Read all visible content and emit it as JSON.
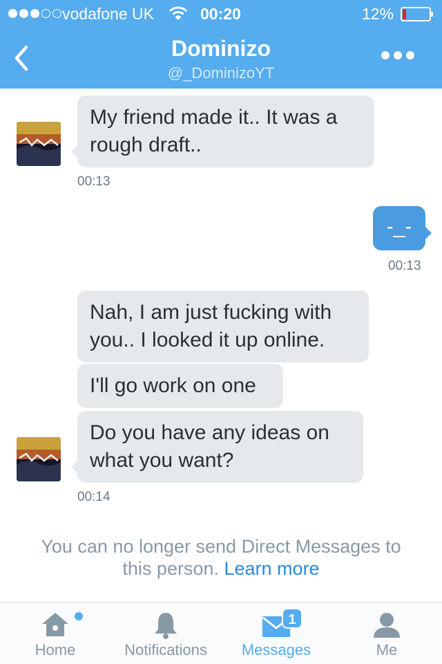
{
  "status_bar": {
    "carrier": "vodafone UK",
    "time": "00:20",
    "battery_percent_text": "12%",
    "battery_level": 0.12,
    "signal_bars": 3,
    "signal_total": 5
  },
  "nav": {
    "title": "Dominizo",
    "handle": "@_DominizoYT"
  },
  "messages": [
    {
      "direction": "incoming",
      "text_lines": [
        "My friend made it.. It was a",
        "rough draft.."
      ]
    },
    {
      "direction": "outgoing",
      "text_lines": [
        "-_-"
      ]
    },
    {
      "direction": "incoming",
      "text_lines": [
        "Nah, I am just fucking with",
        "you.. I looked it up online."
      ]
    },
    {
      "direction": "incoming",
      "text_lines": [
        "I'll go work on one"
      ]
    },
    {
      "direction": "incoming",
      "text_lines": [
        "Do you have any ideas on",
        "what you want?"
      ]
    }
  ],
  "timestamps": [
    "00:13",
    "00:13",
    "00:14"
  ],
  "notice": {
    "line1": "You can no longer send Direct Messages to",
    "line2": "this person.",
    "link": "Learn more"
  },
  "tabs": [
    {
      "label": "Home",
      "icon": "home-icon",
      "badge": "dot"
    },
    {
      "label": "Notifications",
      "icon": "bell-icon"
    },
    {
      "label": "Messages",
      "icon": "envelope-icon",
      "badge_count": "1",
      "active": true
    },
    {
      "label": "Me",
      "icon": "person-icon"
    }
  ],
  "colors": {
    "brand": "#55ACEE",
    "incoming_bubble": "#E6E9EC",
    "outgoing_bubble": "#4A9BE0",
    "battery_low": "#E0281E"
  }
}
